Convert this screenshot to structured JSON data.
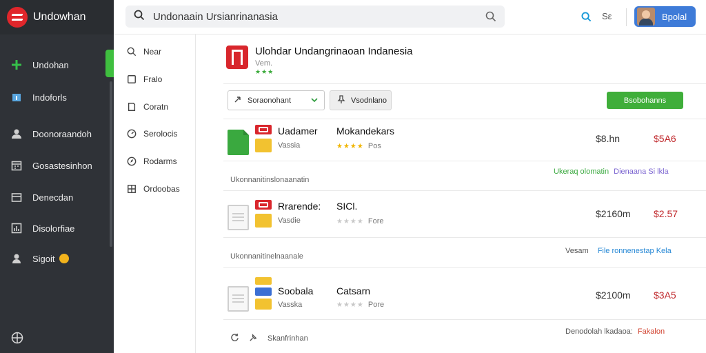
{
  "brand": {
    "name": "Undowhan"
  },
  "sidebar": {
    "items": [
      {
        "label": "Undohan",
        "icon": "apps-icon"
      },
      {
        "label": "Indoforls",
        "icon": "info-icon"
      },
      {
        "label": "Doonoraandoh",
        "icon": "user-icon"
      },
      {
        "label": "Gosastesinhon",
        "icon": "calendar-icon"
      },
      {
        "label": "Denecdan",
        "icon": "folder-icon"
      },
      {
        "label": "Disolorfiae",
        "icon": "chart-icon"
      },
      {
        "label": "Sigoit",
        "icon": "person-icon"
      }
    ]
  },
  "search": {
    "value": "Undonaain Ursianrinanasia"
  },
  "topbar": {
    "s_label": "Sε",
    "profile_label": "Bpolal"
  },
  "subnav": {
    "items": [
      {
        "label": "Near",
        "icon": "search-icon"
      },
      {
        "label": "Fralo",
        "icon": "square-icon"
      },
      {
        "label": "Coratn",
        "icon": "bookmark-icon"
      },
      {
        "label": "Serolocis",
        "icon": "gauge-icon"
      },
      {
        "label": "Rodarms",
        "icon": "compass-icon"
      },
      {
        "label": "Ordoobas",
        "icon": "grid-icon"
      }
    ]
  },
  "app": {
    "title": "Ulohdar Undangrinaoan Indanesia",
    "subtitle": "Vem.",
    "stars": "★★★"
  },
  "toolbar": {
    "dropdown_label": "Soraonohant",
    "filter_label": "Vsodnlano",
    "green_label": "Bsobohanns"
  },
  "rows": [
    {
      "name": "Uadamer",
      "sub": "Vassia",
      "col2": "Mokandekars",
      "stars_on": 4,
      "stars_off": 0,
      "stars_label": "Pos",
      "price1": "$8.hn",
      "price2": "$5A6"
    },
    {
      "name": "Rrarende:",
      "sub": "Vasdie",
      "col2": "SICl.",
      "stars_on": 0,
      "stars_off": 4,
      "stars_label": "Fore",
      "price1": "$2160m",
      "price2": "$2.57"
    },
    {
      "name": "Soobala",
      "sub": "Vasska",
      "col2": "Catsarn",
      "stars_on": 0,
      "stars_off": 4,
      "stars_label": "Pore",
      "price1": "$2100m",
      "price2": "$3A5"
    }
  ],
  "sections": [
    {
      "label": "Ukonnanitinslonaanatin",
      "right_a": "Ukeraq olomatin",
      "right_b": "Dienaana Si lkla",
      "color_a": "#3aa93f",
      "color_b": "#7a63d0"
    },
    {
      "label": "Ukonnanitinelnaanale",
      "right_a": "Vesam",
      "right_b": "File ronnenestap Kela",
      "color_a": "#555555",
      "color_b": "#2a8ad6"
    }
  ],
  "footer": {
    "label": "Skanfrinhan",
    "right_a": "Denodolah lkadaoa:",
    "right_b": "Fakalon",
    "color_b": "#d0402d"
  }
}
